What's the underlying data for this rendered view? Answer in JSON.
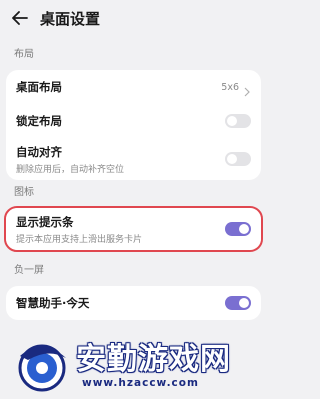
{
  "header": {
    "title": "桌面设置"
  },
  "sections": {
    "layout": {
      "label": "布局",
      "desktop_layout": {
        "title": "桌面布局",
        "value": "5x6"
      },
      "lock_layout": {
        "title": "锁定布局",
        "state": "off"
      },
      "auto_align": {
        "title": "自动对齐",
        "subtitle": "删除应用后，自动补齐空位",
        "state": "off"
      }
    },
    "icons": {
      "label": "图标",
      "show_hint_bar": {
        "title": "显示提示条",
        "subtitle": "提示本应用支持上滑出服务卡片",
        "state": "on"
      }
    },
    "minus_one": {
      "label": "负一屏",
      "smart_assistant": {
        "title": "智慧助手·今天",
        "state": "on"
      }
    }
  },
  "watermark": {
    "name": "安勤游戏网",
    "url": "www.hzaccw.com"
  },
  "colors": {
    "accent": "#7a6fd1",
    "highlight": "#e0474f",
    "background": "#f1f1f3"
  }
}
